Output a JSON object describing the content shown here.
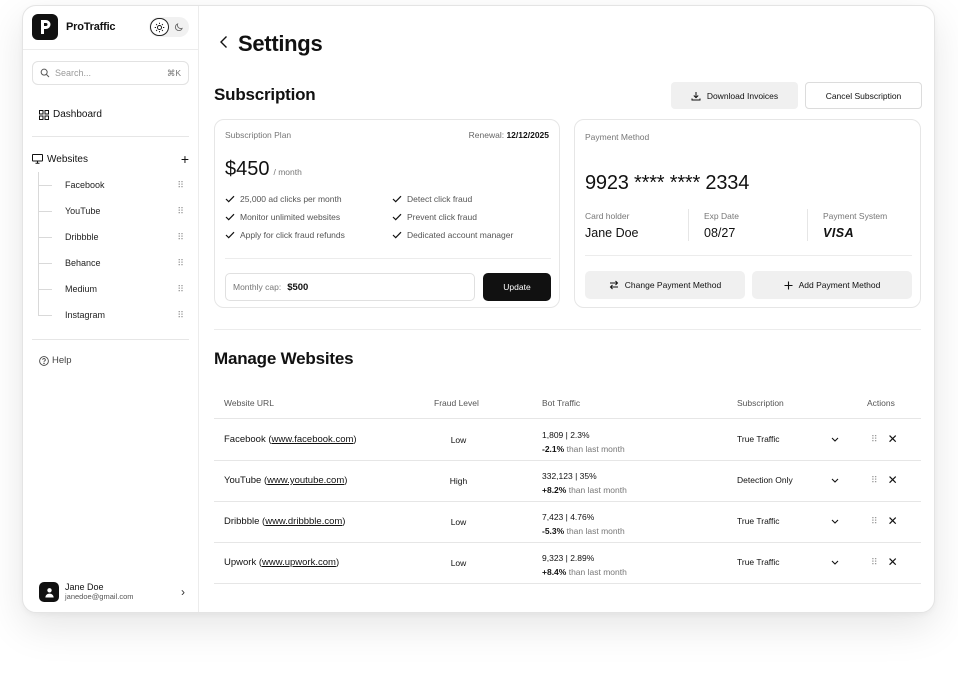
{
  "app": {
    "name": "ProTraffic"
  },
  "sidebar": {
    "search_placeholder": "Search...",
    "search_shortcut": "⌘K",
    "dashboard_label": "Dashboard",
    "websites_label": "Websites",
    "websites": [
      "Facebook",
      "YouTube",
      "Dribbble",
      "Behance",
      "Medium",
      "Instagram"
    ],
    "help_label": "Help",
    "user": {
      "name": "Jane Doe",
      "email": "janedoe@gmail.com"
    }
  },
  "page": {
    "title": "Settings"
  },
  "subscription": {
    "title": "Subscription",
    "download_invoices": "Download Invoices",
    "cancel_subscription": "Cancel Subscription",
    "plan": {
      "label": "Subscription Plan",
      "renewal_label": "Renewal:",
      "renewal_date": "12/12/2025",
      "price": "$450",
      "period": "/ month",
      "features": [
        "25,000 ad clicks per month",
        "Monitor unlimited websites",
        "Apply for click fraud refunds",
        "Detect click fraud",
        "Prevent click fraud",
        "Dedicated account manager"
      ],
      "cap_label": "Monthly cap:",
      "cap_value": "$500",
      "update_button": "Update"
    },
    "payment": {
      "label": "Payment Method",
      "card_number": "9923 **** **** 2334",
      "holder_label": "Card holder",
      "holder": "Jane Doe",
      "exp_label": "Exp Date",
      "exp": "08/27",
      "system_label": "Payment System",
      "system": "VISA",
      "change_button": "Change Payment Method",
      "add_button": "Add Payment Method"
    }
  },
  "manage": {
    "title": "Manage Websites",
    "columns": [
      "Website URL",
      "Fraud Level",
      "Bot Traffic",
      "Subscription",
      "Actions"
    ],
    "rows": [
      {
        "name": "Facebook",
        "url": "www.facebook.com",
        "fraud": "Low",
        "traffic": "1,809 | 2.3%",
        "change": "-2.1%",
        "change_note": "than last month",
        "subscription": "True Traffic"
      },
      {
        "name": "YouTube",
        "url": "www.youtube.com",
        "fraud": "High",
        "traffic": "332,123 | 35%",
        "change": "+8.2%",
        "change_note": "than last month",
        "subscription": "Detection Only"
      },
      {
        "name": "Dribbble",
        "url": "www.dribbble.com",
        "fraud": "Low",
        "traffic": "7,423 | 4.76%",
        "change": "-5.3%",
        "change_note": "than last month",
        "subscription": "True Traffic"
      },
      {
        "name": "Upwork",
        "url": "www.upwork.com",
        "fraud": "Low",
        "traffic": "9,323 | 2.89%",
        "change": "+8.4%",
        "change_note": "than last month",
        "subscription": "True Traffic"
      }
    ]
  }
}
